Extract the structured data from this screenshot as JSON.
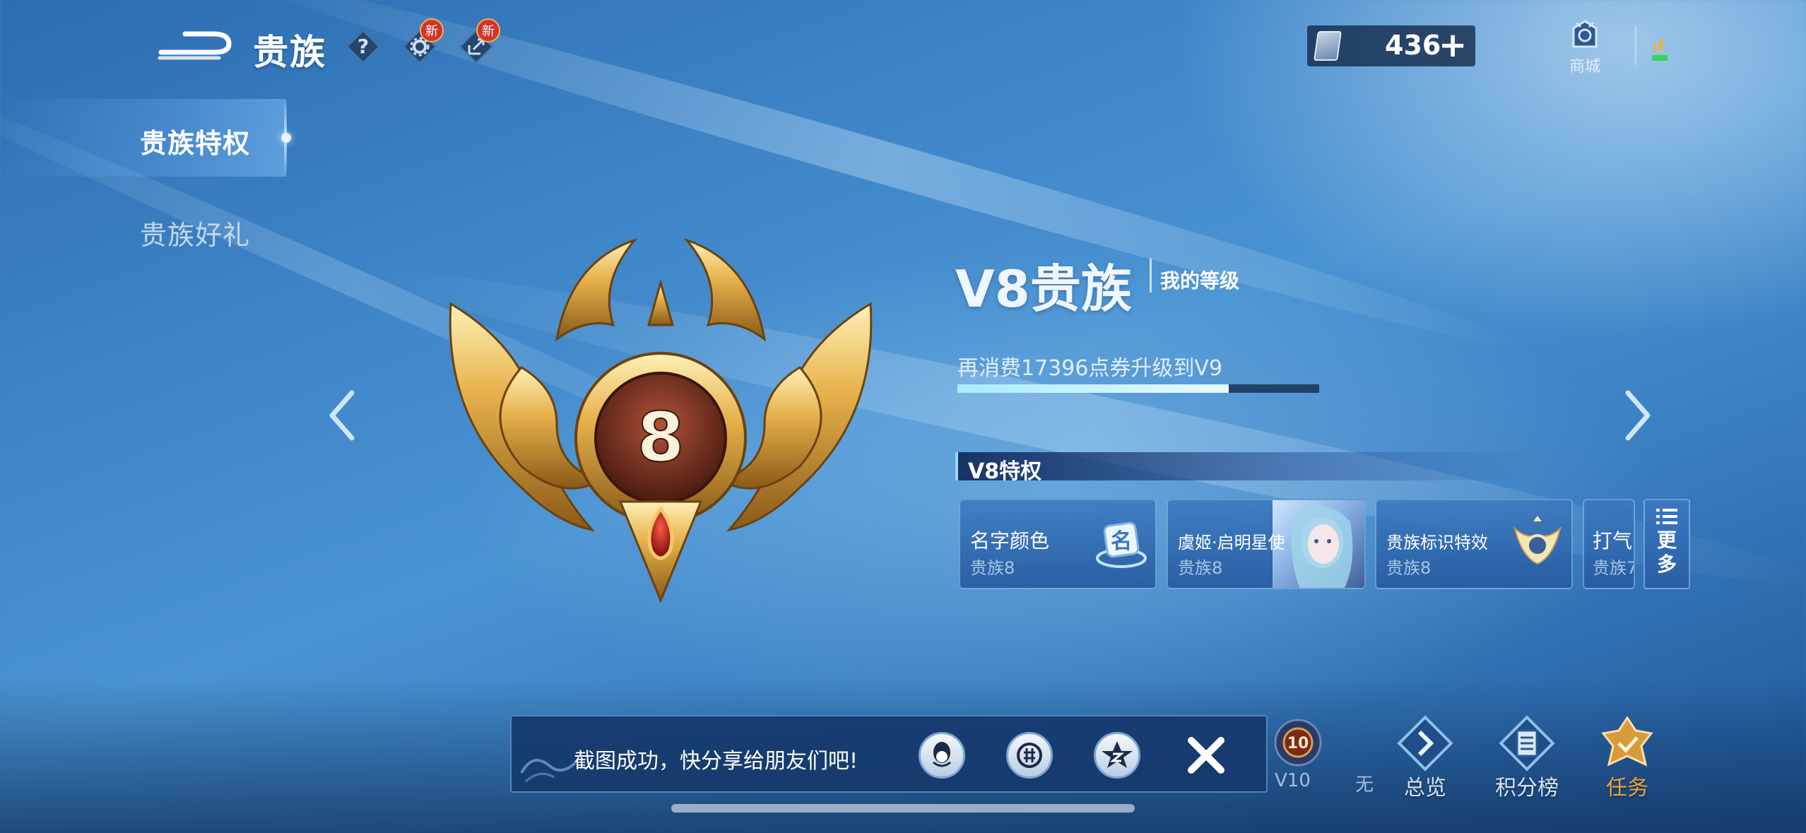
{
  "header": {
    "title": "贵族",
    "help_glyph": "?",
    "settings_badge": "新",
    "share_badge": "新",
    "currency_value": "436",
    "currency_plus": "+",
    "shop_label": "商城"
  },
  "sidebar": {
    "items": [
      {
        "label": "贵族特权",
        "active": true
      },
      {
        "label": "贵族好礼",
        "active": false
      }
    ]
  },
  "badge": {
    "level_number": "8"
  },
  "level": {
    "title": "V8贵族",
    "my_level_label": "我的等级",
    "upgrade_text": "再消费17396点券升级到V9",
    "progress": 0.75
  },
  "privileges": {
    "header": "V8特权",
    "cards": [
      {
        "name": "名字颜色",
        "sub": "贵族8",
        "icon": "name-color-icon"
      },
      {
        "name": "虞姬·启明星使",
        "sub": "贵族8",
        "icon": "hero-skin-portrait"
      },
      {
        "name": "贵族标识特效",
        "sub": "贵族8",
        "icon": "noble-emblem-icon"
      },
      {
        "name": "打气",
        "sub": "贵族7",
        "icon": ""
      }
    ],
    "more_label_1": "更",
    "more_label_2": "多"
  },
  "toast": {
    "text": "截图成功，快分享给朋友们吧!",
    "share_targets": [
      "qq-icon",
      "wechat-moments-icon",
      "qzone-icon"
    ]
  },
  "bottom_nav": {
    "v10_label": "V10",
    "v10_badge": "10",
    "partial_label": "无",
    "items": [
      {
        "label": "总览",
        "icon": "overview-icon"
      },
      {
        "label": "积分榜",
        "icon": "leaderboard-icon"
      },
      {
        "label": "任务",
        "icon": "task-icon"
      }
    ]
  },
  "colors": {
    "accent_gold": "#e8b24a",
    "progress_fill": "#c6f2ff",
    "new_badge": "#d0352b",
    "task_label": "#f0a23a"
  }
}
